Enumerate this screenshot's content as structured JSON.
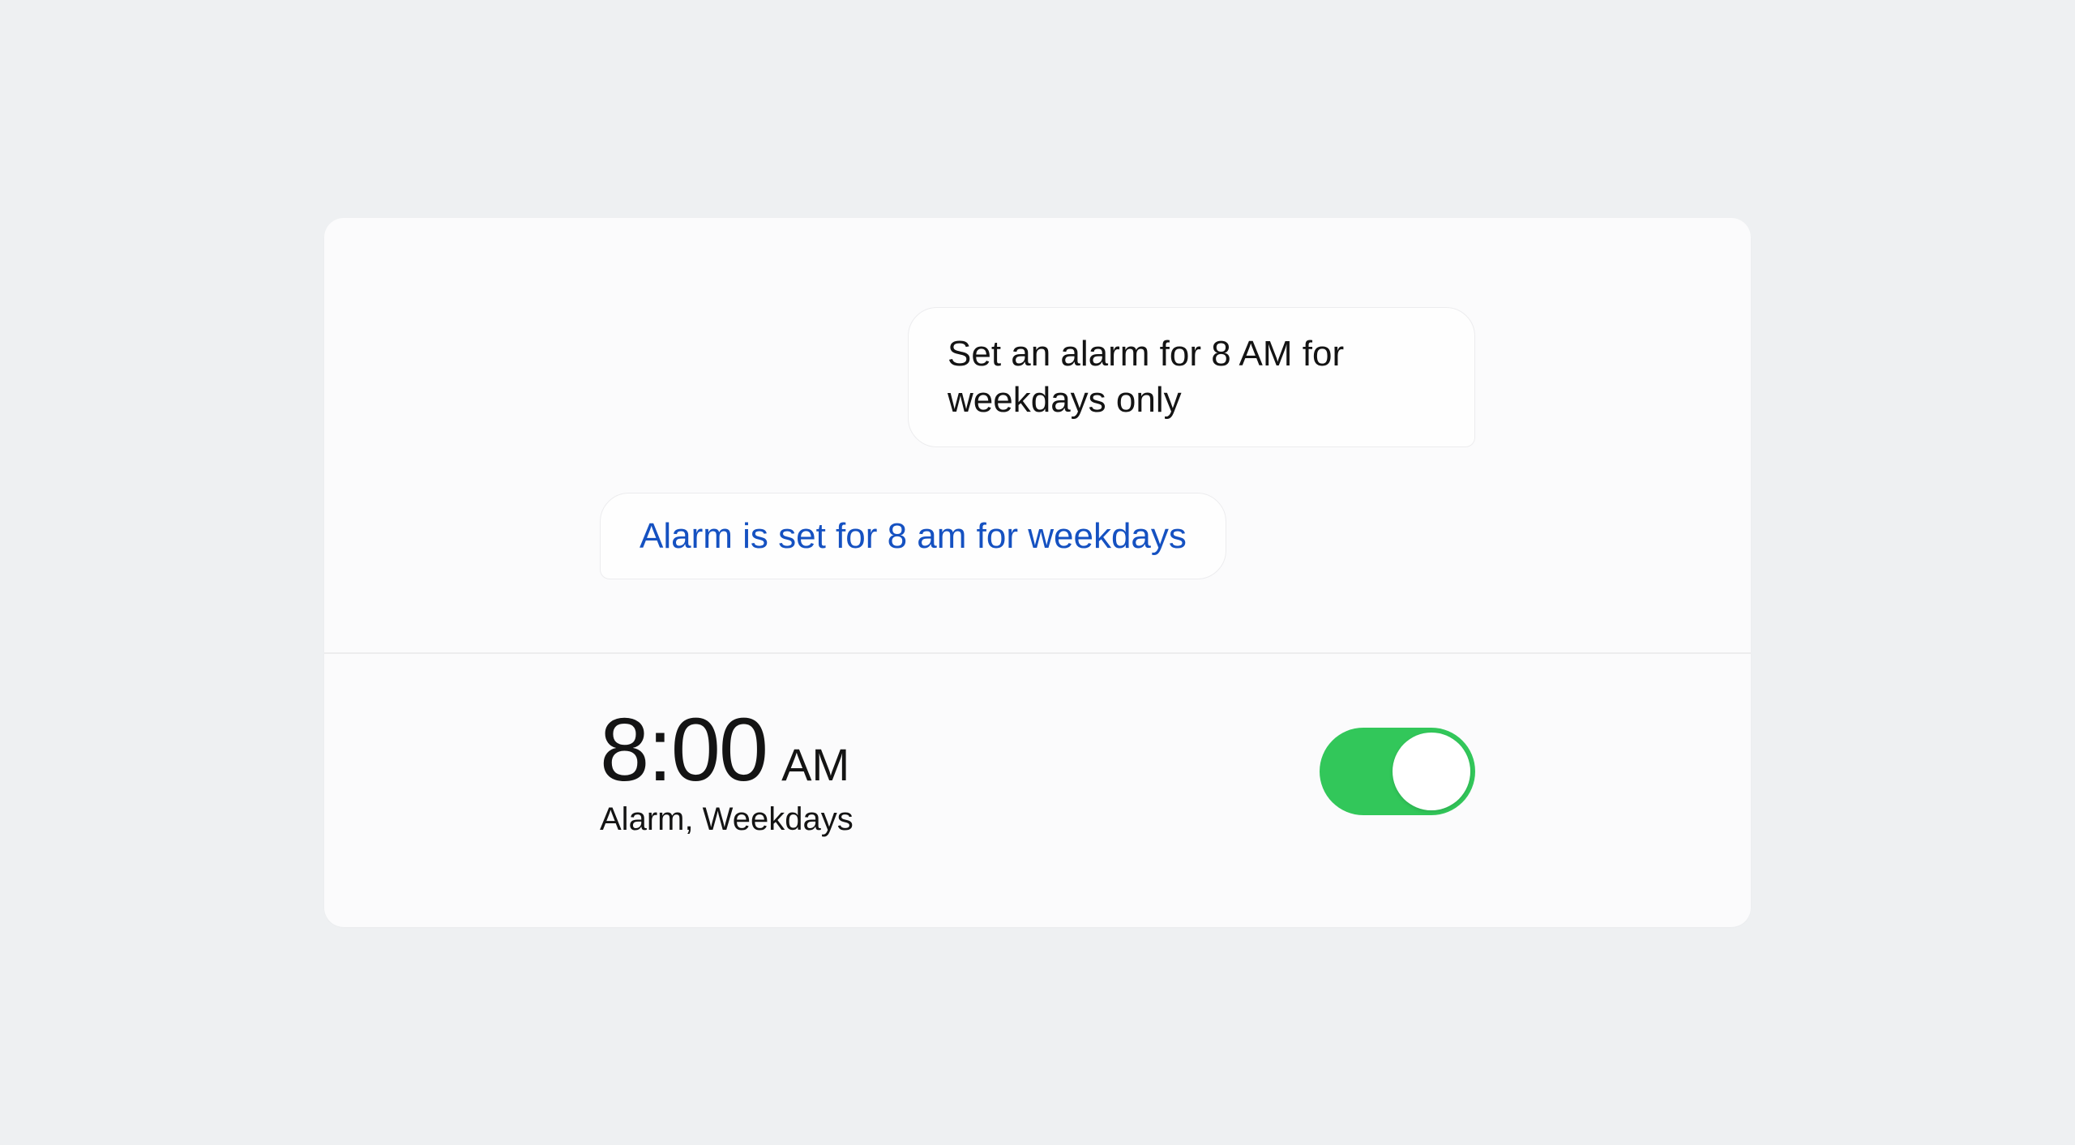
{
  "chat": {
    "user_message": "Set an alarm for 8 AM for weekdays only",
    "assistant_message": "Alarm is set for 8 am for weekdays"
  },
  "alarm": {
    "time": "8:00",
    "period": "AM",
    "subtitle": "Alarm, Weekdays",
    "enabled": true
  },
  "colors": {
    "accent_blue": "#1551c1",
    "toggle_green": "#32c75a",
    "text": "#141414",
    "card_bg": "#fbfbfc",
    "page_bg": "#eef0f2"
  }
}
